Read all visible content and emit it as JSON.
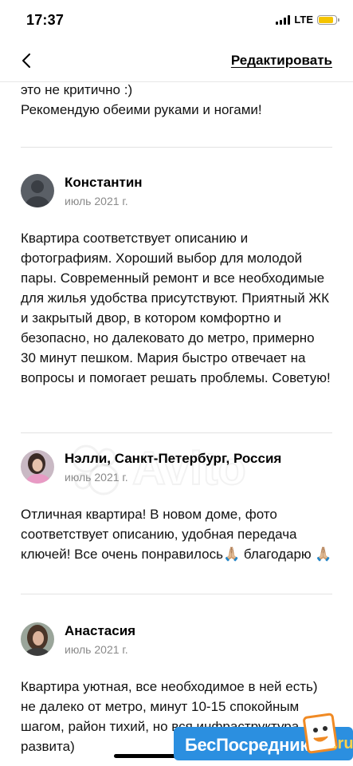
{
  "status_bar": {
    "time": "17:37",
    "network": "LTE",
    "battery_level": 0.85,
    "battery_color": "#f5c400"
  },
  "nav": {
    "back_icon": "chevron-left-icon",
    "edit_label": "Редактировать"
  },
  "previous_review": {
    "lines": [
      "это не критично :)",
      "Рекомендую обеими руками и ногами!"
    ]
  },
  "reviews": [
    {
      "author": "Константин",
      "date": "июль 2021 г.",
      "avatar": "placeholder-user-icon",
      "text": "Квартира соответствует описанию и фотографиям. Хороший выбор для молодой пары. Современный ремонт и все необходимые для жилья удобства присутствуют. Приятный ЖК и закрытый двор, в котором комфортно и безопасно, но далековато до метро, примерно 30 минут пешком. Мария быстро отвечает на вопросы и помогает решать проблемы. Советую!"
    },
    {
      "author": "Нэлли, Санкт-Петербург, Россия",
      "date": "июль 2021 г.",
      "avatar": "user-photo",
      "text": "Отличная квартира! В новом доме, фото соответствует описанию, удобная передача ключей! Все очень понравилось🙏🏼 благодарю 🙏🏼"
    },
    {
      "author": "Анастасия",
      "date": "июль 2021 г.",
      "avatar": "user-photo",
      "text": "Квартира уютная, все необходимое в ней есть) не далеко от метро, минут 10-15 спокойным шагом, район тихий, но вся инфраструктура развита)"
    }
  ],
  "watermark": {
    "brand": "Avito"
  },
  "badge": {
    "label": "БесПосредника",
    "suffix": ".ru",
    "color": "#2b8fe0"
  }
}
